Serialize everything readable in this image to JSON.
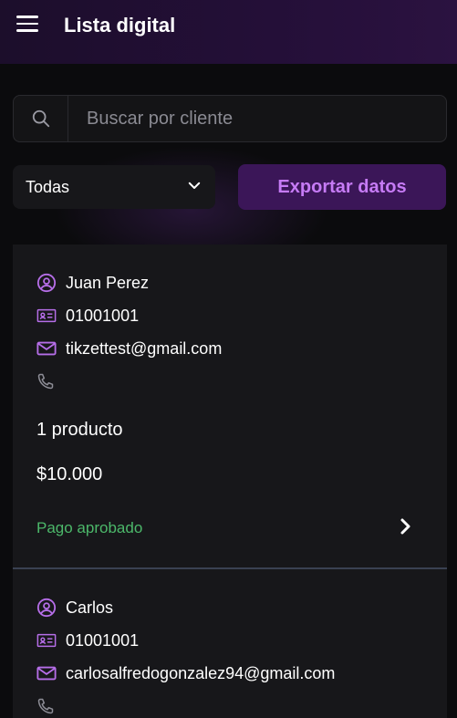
{
  "header": {
    "title": "Lista digital"
  },
  "search": {
    "placeholder": "Buscar por cliente"
  },
  "filter": {
    "selected": "Todas"
  },
  "toolbar": {
    "export_label": "Exportar datos"
  },
  "colors": {
    "accent": "#c67bf5",
    "status_ok": "#4cb86a"
  },
  "orders": [
    {
      "name": "Juan Perez",
      "dni": "01001001",
      "email": "tikzettest@gmail.com",
      "phone": "",
      "products": "1 producto",
      "amount": "$10.000",
      "status": "Pago aprobado"
    },
    {
      "name": "Carlos",
      "dni": "01001001",
      "email": "carlosalfredogonzalez94@gmail.com",
      "phone": ""
    }
  ]
}
